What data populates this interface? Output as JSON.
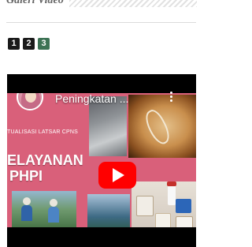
{
  "widget": {
    "title": "Galeri Video"
  },
  "pagination": {
    "pages": [
      "1",
      "2",
      "3"
    ],
    "active_page": "3"
  },
  "video": {
    "title": "Peningkatan ...",
    "channel_avatar_icon": "woman-avatar",
    "play_icon": "youtube-play-icon",
    "menu_icon": "more-vert-icon"
  },
  "thumbnail": {
    "subtitle": "TUALISASI LATSAR CPNS",
    "headline_line1": "ELAYANAN",
    "headline_line2": "PHPI"
  },
  "colors": {
    "pink_background": "#d9607a",
    "active_page": "#3c7254",
    "youtube_red": "#ff0000"
  }
}
